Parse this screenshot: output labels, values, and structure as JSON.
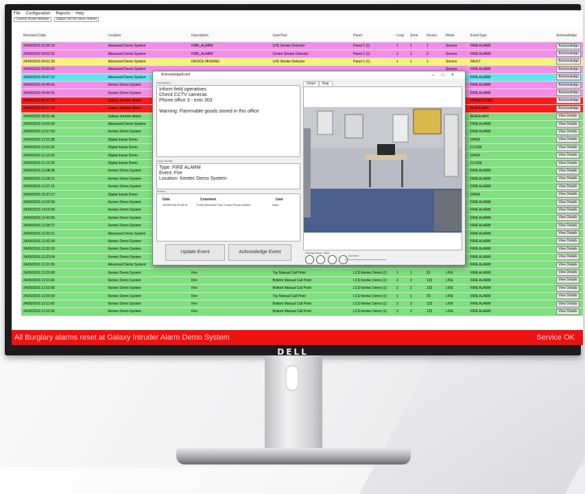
{
  "menu": [
    "File",
    "Configuration",
    "Reports",
    "Help"
  ],
  "toolbar": [
    "Control Room Monitor",
    "Status (00:00 since online)"
  ],
  "columns": [
    "Received Date",
    "Location",
    "Description",
    "User/Text",
    "Panel",
    "Loop",
    "Zone",
    "Device",
    "Mode",
    "EventType",
    "Acknowledge"
  ],
  "rows": [
    {
      "date": "24/05/2016 10:26:18",
      "loc": "Advanced Demo System",
      "desc": "FIRE_ALARM",
      "user": "LHS Smoke Detector",
      "panel": "Panel 1 (1)",
      "loop": "1",
      "zone": "1",
      "dev": "1",
      "mode": "Service",
      "type": "FIRE ALARM",
      "ack": "Acknowledge",
      "color": "#f28ee8"
    },
    {
      "date": "24/05/2016 09:52:51",
      "loc": "Advanced Demo System",
      "desc": "FIRE_ALARM",
      "user": "Centre Smoke Detector",
      "panel": "Panel 1 (1)",
      "loop": "1",
      "zone": "1",
      "dev": "2",
      "mode": "Service",
      "type": "FIRE ALARM",
      "ack": "Acknowledge",
      "color": "#f28ee8"
    },
    {
      "date": "24/05/2016 09:51:30",
      "loc": "Advanced Demo System",
      "desc": "DEVICE MISSING",
      "user": "LHS Smoke Detector",
      "panel": "Panel 1 (1)",
      "loop": "1",
      "zone": "1",
      "dev": "1",
      "mode": "Service",
      "type": "FAULT",
      "ack": "Acknowledge",
      "color": "#f6f27a"
    },
    {
      "date": "24/05/2016 09:50:02",
      "loc": "Advanced Demo System",
      "desc": "",
      "user": "",
      "panel": "",
      "loop": "",
      "zone": "",
      "dev": "",
      "mode": "Service",
      "type": "FIRE ALARM",
      "ack": "Acknowledge",
      "color": "#f28ee8"
    },
    {
      "date": "24/05/2016 09:47:12",
      "loc": "Advanced Demo System",
      "desc": "",
      "user": "",
      "panel": "",
      "loop": "",
      "zone": "",
      "dev": "",
      "mode": "Day Test",
      "type": "FIRE ALARM",
      "ack": "Acknowledge",
      "color": "#5fe6ef"
    },
    {
      "date": "24/05/2016 09:45:41",
      "loc": "Kentec Demo System",
      "desc": "",
      "user": "",
      "panel": "",
      "loop": "",
      "zone": "",
      "dev": "",
      "mode": "Service",
      "type": "FIRE ALARM",
      "ack": "Acknowledge",
      "color": "#f28ee8"
    },
    {
      "date": "24/05/2016 09:44:31",
      "loc": "Kentec Demo System",
      "desc": "",
      "user": "",
      "panel": "",
      "loop": "",
      "zone": "",
      "dev": "",
      "mode": "Service",
      "type": "FIRE ALARM",
      "ack": "Acknowledge",
      "color": "#f28ee8"
    },
    {
      "date": "24/05/2016 09:37:10",
      "loc": "Galaxy Intruder Alarm",
      "desc": "",
      "user": "",
      "panel": "",
      "loop": "",
      "zone": "",
      "dev": "",
      "mode": "",
      "type": "UNSET/CODE",
      "ack": "Acknowledge",
      "color": "#ff1a1a"
    },
    {
      "date": "24/05/2016 09:37:10",
      "loc": "Galaxy Intruder Alarm",
      "desc": "",
      "user": "",
      "panel": "",
      "loop": "",
      "zone": "",
      "dev": "",
      "mode": "",
      "type": "BURGLARY",
      "ack": "Acknowledge",
      "color": "#ff1a1a"
    },
    {
      "date": "24/05/2016 09:31:46",
      "loc": "Galaxy Intruder Alarm",
      "desc": "",
      "user": "",
      "panel": "",
      "loop": "",
      "zone": "",
      "dev": "",
      "mode": "",
      "type": "BURGLARY",
      "ack": "View Details",
      "color": "#7ee07e"
    },
    {
      "date": "24/05/2016 14:20:42",
      "loc": "Advanced Demo System",
      "desc": "",
      "user": "",
      "panel": "",
      "loop": "",
      "zone": "",
      "dev": "",
      "mode": "",
      "type": "FIRE ALARM",
      "ack": "View Details",
      "color": "#7ee07e"
    },
    {
      "date": "24/05/2016 12:27:53",
      "loc": "Kentec Demo System",
      "desc": "",
      "user": "",
      "panel": "",
      "loop": "",
      "zone": "",
      "dev": "",
      "mode": "Day Test",
      "type": "FIRE ALARM",
      "ack": "View Details",
      "color": "#7ee07e"
    },
    {
      "date": "24/05/2016 11:51:38",
      "loc": "Digital Inputs Demo",
      "desc": "",
      "user": "",
      "panel": "",
      "loop": "",
      "zone": "",
      "dev": "",
      "mode": "",
      "type": "OPEN",
      "ack": "View Details",
      "color": "#7ee07e"
    },
    {
      "date": "24/05/2016 11:51:32",
      "loc": "Digital Inputs Demo",
      "desc": "",
      "user": "",
      "panel": "",
      "loop": "",
      "zone": "",
      "dev": "",
      "mode": "",
      "type": "CLOSE",
      "ack": "View Details",
      "color": "#7ee07e"
    },
    {
      "date": "24/05/2016 11:12:23",
      "loc": "Digital Inputs Demo",
      "desc": "",
      "user": "",
      "panel": "",
      "loop": "",
      "zone": "",
      "dev": "",
      "mode": "",
      "type": "OPEN",
      "ack": "View Details",
      "color": "#7ee07e"
    },
    {
      "date": "24/05/2016 11:12:20",
      "loc": "Digital Inputs Demo",
      "desc": "",
      "user": "",
      "panel": "",
      "loop": "",
      "zone": "",
      "dev": "",
      "mode": "",
      "type": "CLOSE",
      "ack": "View Details",
      "color": "#7ee07e"
    },
    {
      "date": "24/05/2016 11:08:28",
      "loc": "Kentec Demo System",
      "desc": "",
      "user": "",
      "panel": "",
      "loop": "",
      "zone": "",
      "dev": "",
      "mode": "",
      "type": "FIRE ALARM",
      "ack": "View Details",
      "color": "#7ee07e"
    },
    {
      "date": "24/05/2016 11:08:21",
      "loc": "Kentec Demo System",
      "desc": "",
      "user": "",
      "panel": "",
      "loop": "",
      "zone": "",
      "dev": "",
      "mode": "",
      "type": "FIRE ALARM",
      "ack": "View Details",
      "color": "#7ee07e"
    },
    {
      "date": "24/05/2016 11:07:13",
      "loc": "Kentec Demo System",
      "desc": "",
      "user": "",
      "panel": "",
      "loop": "",
      "zone": "",
      "dev": "",
      "mode": "",
      "type": "FIRE ALARM",
      "ack": "View Details",
      "color": "#7ee07e"
    },
    {
      "date": "24/05/2016 15:37:17",
      "loc": "Digital Inputs Demo",
      "desc": "",
      "user": "",
      "panel": "",
      "loop": "",
      "zone": "",
      "dev": "",
      "mode": "",
      "type": "OPEN",
      "ack": "View Details",
      "color": "#7ee07e"
    },
    {
      "date": "24/05/2016 14:20:56",
      "loc": "Kentec Demo System",
      "desc": "",
      "user": "",
      "panel": "",
      "loop": "",
      "zone": "",
      "dev": "",
      "mode": "",
      "type": "FIRE ALARM",
      "ack": "View Details",
      "color": "#7ee07e"
    },
    {
      "date": "24/05/2016 14:15:06",
      "loc": "Kentec Demo System",
      "desc": "",
      "user": "",
      "panel": "",
      "loop": "",
      "zone": "",
      "dev": "",
      "mode": "",
      "type": "FIRE ALARM",
      "ack": "View Details",
      "color": "#7ee07e"
    },
    {
      "date": "24/05/2016 12:43:56",
      "loc": "Kentec Demo System",
      "desc": "",
      "user": "",
      "panel": "",
      "loop": "",
      "zone": "",
      "dev": "",
      "mode": "",
      "type": "FIRE ALARM",
      "ack": "View Details",
      "color": "#7ee07e"
    },
    {
      "date": "24/05/2016 12:38:27",
      "loc": "Kentec Demo System",
      "desc": "",
      "user": "",
      "panel": "",
      "loop": "",
      "zone": "",
      "dev": "",
      "mode": "",
      "type": "FIRE ALARM",
      "ack": "View Details",
      "color": "#7ee07e"
    },
    {
      "date": "24/05/2016 12:33:11",
      "loc": "Advanced Demo System",
      "desc": "",
      "user": "",
      "panel": "",
      "loop": "",
      "zone": "",
      "dev": "",
      "mode": "",
      "type": "FIRE ALARM",
      "ack": "View Details",
      "color": "#7ee07e"
    },
    {
      "date": "24/05/2016 12:32:34",
      "loc": "Kentec Demo System",
      "desc": "",
      "user": "",
      "panel": "",
      "loop": "",
      "zone": "",
      "dev": "",
      "mode": "",
      "type": "FIRE ALARM",
      "ack": "View Details",
      "color": "#7ee07e"
    },
    {
      "date": "24/05/2016 12:32:20",
      "loc": "Kentec Demo System",
      "desc": "FIRE_ALARM",
      "user": "MCP - MCP - MCP - MCP",
      "panel": "Panel 1 (1)",
      "loop": "1",
      "zone": "1",
      "dev": "4",
      "mode": "LIVE",
      "type": "FIRE ALARM",
      "ack": "View Details",
      "color": "#7ee07e"
    },
    {
      "date": "24/05/2016 12:23:04",
      "loc": "Kentec Demo System",
      "desc": "Fire",
      "user": "Toy Manual Call Point",
      "panel": "LCS Kentec Demo (1)",
      "loop": "1",
      "zone": "1",
      "dev": "33",
      "mode": "LIVE",
      "type": "FIRE ALARM",
      "ack": "View Details",
      "color": "#7ee07e"
    },
    {
      "date": "24/05/2016 12:21:56",
      "loc": "Advanced Demo System",
      "desc": "FIRE_ALARM",
      "user": "MCP - MCP - MCP - MCP",
      "panel": "Panel 1 (1)",
      "loop": "1",
      "zone": "1",
      "dev": "4",
      "mode": "LIVE",
      "type": "FIRE ALARM",
      "ack": "View Details",
      "color": "#7ee07e"
    },
    {
      "date": "24/05/2016 12:20:08",
      "loc": "Kentec Demo System",
      "desc": "Fire",
      "user": "Toy Manual Call Point",
      "panel": "LCS Kentec Demo (1)",
      "loop": "1",
      "zone": "1",
      "dev": "33",
      "mode": "LIVE",
      "type": "FIRE ALARM",
      "ack": "View Details",
      "color": "#7ee07e"
    },
    {
      "date": "24/05/2016 12:11:42",
      "loc": "Kentec Demo System",
      "desc": "Fire",
      "user": "Bottom Manual Call Point",
      "panel": "LCS Kentec Demo (1)",
      "loop": "2",
      "zone": "2",
      "dev": "123",
      "mode": "LIVE",
      "type": "FIRE ALARM",
      "ack": "View Details",
      "color": "#7ee07e"
    },
    {
      "date": "24/05/2016 11:52:58",
      "loc": "Kentec Demo System",
      "desc": "Fire",
      "user": "Bottom Manual Call Point",
      "panel": "LCS Kentec Demo (1)",
      "loop": "2",
      "zone": "2",
      "dev": "123",
      "mode": "LIVE",
      "type": "FIRE ALARM",
      "ack": "View Details",
      "color": "#7ee07e"
    },
    {
      "date": "24/05/2016 12:00:09",
      "loc": "Kentec Demo System",
      "desc": "Fire",
      "user": "Toy Manual Call Point",
      "panel": "LCS Kentec Demo (1)",
      "loop": "1",
      "zone": "1",
      "dev": "33",
      "mode": "LIVE",
      "type": "FIRE ALARM",
      "ack": "View Details",
      "color": "#7ee07e"
    },
    {
      "date": "24/05/2016 12:11:42",
      "loc": "Kentec Demo System",
      "desc": "Fire",
      "user": "Bottom Manual Call Point",
      "panel": "LCS Kentec Demo (1)",
      "loop": "2",
      "zone": "2",
      "dev": "123",
      "mode": "LIVE",
      "type": "FIRE ALARM",
      "ack": "View Details",
      "color": "#7ee07e"
    },
    {
      "date": "24/05/2016 11:52:56",
      "loc": "Kentec Demo System",
      "desc": "Fire",
      "user": "Bottom Manual Call Point",
      "panel": "LCS Kentec Demo (1)",
      "loop": "2",
      "zone": "2",
      "dev": "123",
      "mode": "LIVE",
      "type": "FIRE ALARM",
      "ack": "View Details",
      "color": "#7ee07e"
    }
  ],
  "dialog": {
    "title": "AcknowledgeEvent",
    "instructions_label": "Instructions",
    "instructions": [
      "Inform field operatives",
      "Check CCTV cameras",
      "Phone office 3 - extn 303",
      "",
      "Warning: Flammable goods stored in this office"
    ],
    "event_details_label": "Event Details",
    "event_details": [
      "Type: FIRE ALARM",
      "Event: Fire",
      "Location: Kentec Demo System"
    ],
    "actions_label": "Actions",
    "actions_cols": [
      "Date",
      "Comment",
      "User"
    ],
    "actions_row": {
      "date": "24/05/2016 09:46:31",
      "comment": "Event Received From Control Room Monitor",
      "user": "None"
    },
    "update_btn": "Update Event",
    "ack_btn": "Acknowledge Event",
    "tabs": [
      "Detail",
      "Map"
    ],
    "playing_label": "Playing Mode: VMS",
    "duration_label": "Duration"
  },
  "status": {
    "left": "All Burglary alarms reset at Galaxy Intruder Alarm Demo System",
    "right": "Service OK",
    "color": "#ee1111"
  },
  "brand": "DELL"
}
